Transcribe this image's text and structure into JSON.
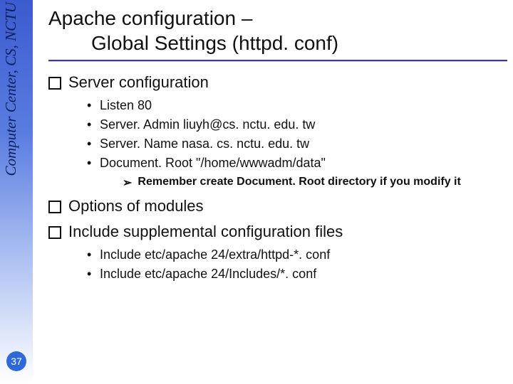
{
  "sidebar": {
    "vertical_text": "Computer Center, CS, NCTU",
    "slide_number": "37"
  },
  "title": {
    "line1": "Apache configuration –",
    "line2": "Global Settings (httpd. conf)"
  },
  "sections": {
    "q1": "Server configuration",
    "s1_items": [
      "Listen 80",
      "Server. Admin liuyh@cs. nctu. edu. tw",
      "Server. Name nasa. cs. nctu. edu. tw",
      "Document. Root \"/home/wwwadm/data\""
    ],
    "note1": "Remember create Document. Root directory if you modify it",
    "q2": "Options of modules",
    "q3": "Include supplemental configuration files",
    "s3_items": [
      "Include etc/apache 24/extra/httpd-*. conf",
      "Include etc/apache 24/Includes/*. conf"
    ]
  }
}
